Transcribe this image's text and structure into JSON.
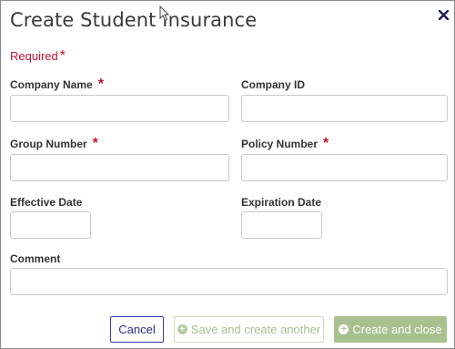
{
  "dialog": {
    "title": "Create Student Insurance",
    "required_note": "Required",
    "required_marker": "*"
  },
  "icons": {
    "close": "close-icon",
    "cursor": "mouse-cursor-icon",
    "plus": "plus-circle-icon"
  },
  "fields": {
    "company_name": {
      "label": "Company Name",
      "value": "",
      "required": true
    },
    "company_id": {
      "label": "Company ID",
      "value": "",
      "required": false
    },
    "group_number": {
      "label": "Group Number",
      "value": "",
      "required": true
    },
    "policy_number": {
      "label": "Policy Number",
      "value": "",
      "required": true
    },
    "effective_date": {
      "label": "Effective Date",
      "value": "",
      "required": false
    },
    "expiration_date": {
      "label": "Expiration Date",
      "value": "",
      "required": false
    },
    "comment": {
      "label": "Comment",
      "value": "",
      "required": false
    }
  },
  "buttons": {
    "cancel": "Cancel",
    "save_and_create_another": "Save and create another",
    "create_and_close": "Create and close"
  },
  "colors": {
    "required_red": "#c8102e",
    "cancel_border": "#3a3a9e",
    "primary_green": "#a7c18f",
    "close_icon": "#1f1f5c"
  }
}
